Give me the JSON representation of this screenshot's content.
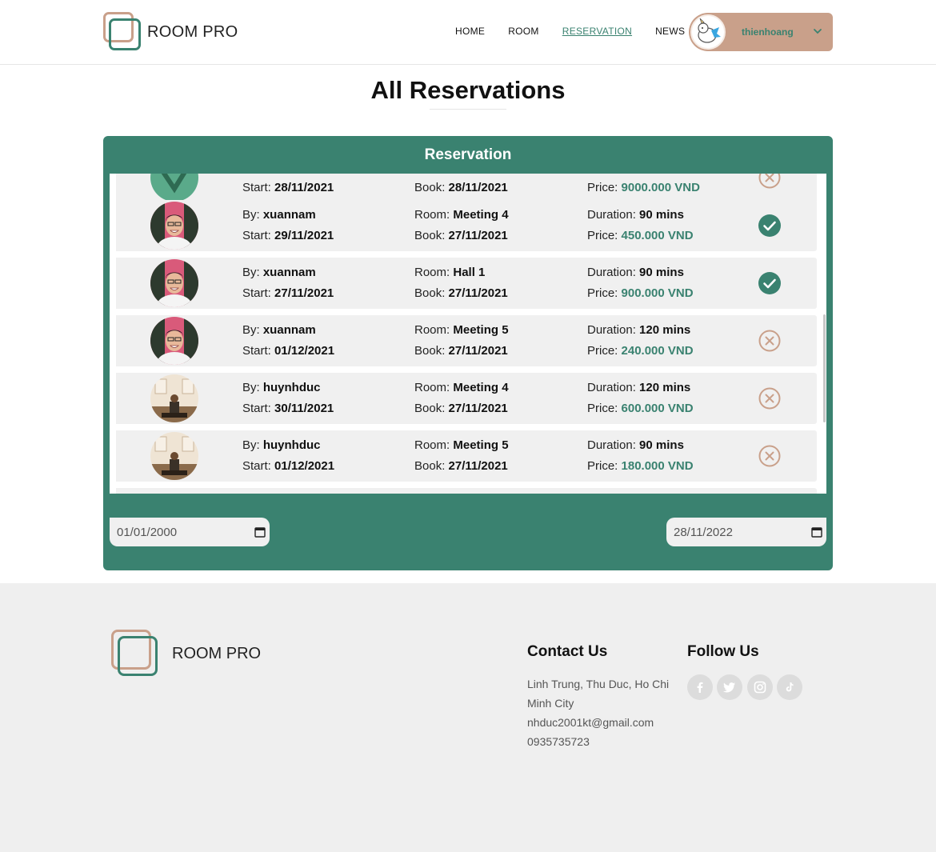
{
  "header": {
    "brand": "ROOM PRO",
    "nav": [
      {
        "label": "HOME",
        "active": false
      },
      {
        "label": "ROOM",
        "active": false
      },
      {
        "label": "RESERVATION",
        "active": true
      },
      {
        "label": "NEWS",
        "active": false
      }
    ],
    "user": {
      "name": "thienhoang",
      "avatar_icon": "unicorn-avatar-icon"
    }
  },
  "page": {
    "title": "All Reservations"
  },
  "reservation_panel": {
    "title": "Reservation",
    "labels": {
      "by": "By: ",
      "start": "Start: ",
      "room": "Room: ",
      "book": "Book: ",
      "duration": "Duration: ",
      "price": "Price: "
    },
    "rows": [
      {
        "by": "",
        "start": "28/11/2021",
        "room": "",
        "book": "28/11/2021",
        "duration": "",
        "price": "9000.000 VND",
        "status": "cancelled",
        "avatar": "partial-avatar",
        "partial": "top"
      },
      {
        "by": "xuannam",
        "start": "29/11/2021",
        "room": "Meeting 4",
        "book": "27/11/2021",
        "duration": "90 mins",
        "price": "450.000 VND",
        "status": "approved",
        "avatar": "xuannam-photo"
      },
      {
        "by": "xuannam",
        "start": "27/11/2021",
        "room": "Hall 1",
        "book": "27/11/2021",
        "duration": "90 mins",
        "price": "900.000 VND",
        "status": "approved",
        "avatar": "xuannam-photo"
      },
      {
        "by": "xuannam",
        "start": "01/12/2021",
        "room": "Meeting 5",
        "book": "27/11/2021",
        "duration": "120 mins",
        "price": "240.000 VND",
        "status": "cancelled",
        "avatar": "xuannam-photo"
      },
      {
        "by": "huynhduc",
        "start": "30/11/2021",
        "room": "Meeting 4",
        "book": "27/11/2021",
        "duration": "120 mins",
        "price": "600.000 VND",
        "status": "cancelled",
        "avatar": "huynhduc-photo"
      },
      {
        "by": "huynhduc",
        "start": "01/12/2021",
        "room": "Meeting 5",
        "book": "27/11/2021",
        "duration": "90 mins",
        "price": "180.000 VND",
        "status": "cancelled",
        "avatar": "huynhduc-photo"
      }
    ],
    "date_from": "01/01/2000",
    "date_to": "28/11/2022"
  },
  "footer": {
    "brand": "ROOM PRO",
    "contact_title": "Contact Us",
    "address": "Linh Trung, Thu Duc, Ho Chi Minh City",
    "email": "nhduc2001kt@gmail.com",
    "phone": "0935735723",
    "follow_title": "Follow Us",
    "socials": [
      "facebook-icon",
      "twitter-icon",
      "instagram-icon",
      "tiktok-icon"
    ]
  },
  "colors": {
    "primary": "#3a8270",
    "accent": "#c9a08a",
    "row_bg": "#f0f0f0",
    "footer_bg": "#efefef"
  }
}
